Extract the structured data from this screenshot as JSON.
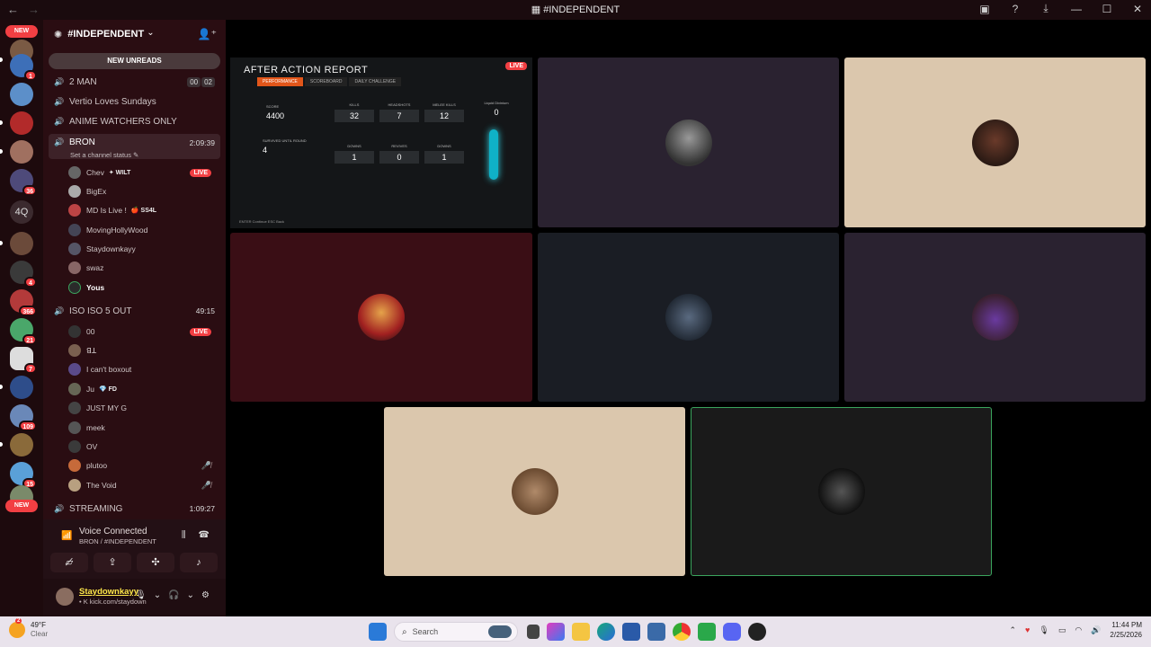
{
  "window": {
    "title": "#INDEPENDENT",
    "back_icon": "←",
    "forward_icon": "→"
  },
  "server_rail": {
    "new_top": "NEW",
    "new_bottom": "NEW",
    "badges": [
      "1",
      "36",
      "4",
      "366",
      "21",
      "7",
      "109",
      "15"
    ],
    "text_server": "4Q"
  },
  "guild": {
    "name": "#INDEPENDENT",
    "chevron": "⌄",
    "new_unreads": "NEW UNREADS"
  },
  "voice_channels": {
    "two_man": {
      "name": "2 MAN",
      "count_a": "00",
      "count_b": "02"
    },
    "vertio": {
      "name": "Vertio Loves Sundays"
    },
    "anime": {
      "name": "ANIME WATCHERS ONLY"
    },
    "bron": {
      "name": "BRON",
      "timer": "2:09:39",
      "status": "Set a channel status ✎"
    },
    "iso": {
      "name": "ISO ISO 5 OUT",
      "timer": "49:15"
    },
    "streaming": {
      "name": "STREAMING",
      "timer": "1:09:27"
    }
  },
  "bron_members": [
    {
      "name": "Chev",
      "tag": "✦ WILT",
      "live": "LIVE"
    },
    {
      "name": "BigEx"
    },
    {
      "name": "MD Is Live !",
      "tag": "🍎 SS4L"
    },
    {
      "name": "MovingHollyWood"
    },
    {
      "name": "Staydownkayy"
    },
    {
      "name": "swaz"
    },
    {
      "name": "Yous"
    }
  ],
  "iso_members": [
    {
      "name": "00",
      "live": "LIVE"
    },
    {
      "name": "ꓭꓕ"
    },
    {
      "name": "I can't boxout"
    },
    {
      "name": "Ju",
      "tag": "💎 FD"
    },
    {
      "name": "JUST MY G"
    },
    {
      "name": "meek"
    },
    {
      "name": "OV"
    },
    {
      "name": "plutoo",
      "mute": "🎤̸"
    },
    {
      "name": "The Void",
      "mute": "🎤̸"
    }
  ],
  "voice_panel": {
    "title": "Voice Connected",
    "subtitle": "BRON / #INDEPENDENT"
  },
  "user_panel": {
    "name": "Staydownkayy",
    "status": "• K kick.com/staydown"
  },
  "game_stream": {
    "title": "AFTER ACTION REPORT",
    "live": "LIVE",
    "tabs": [
      "PERFORMANCE",
      "SCOREBOARD",
      "DAILY CHALLENGE"
    ],
    "score_label": "SCORE",
    "score": "4400",
    "round_label": "SURVIVED UNTIL ROUND",
    "round": "4",
    "kills_label": "KILLS",
    "kills": "32",
    "headshots_label": "HEADSHOTS",
    "headshots": "7",
    "melee_label": "MELEE KILLS",
    "melee": "12",
    "downs_label": "DOWNS",
    "downs": "1",
    "revives_label": "REVIVES",
    "revives": "0",
    "downs2_label": "DOWNS",
    "downs2": "1",
    "liquid_label": "Liquid Divinium",
    "liquid": "0",
    "footer": "ENTER Continue   ESC Back"
  },
  "taskbar": {
    "temp": "49°F",
    "weather": "Clear",
    "weather_badge": "2",
    "search": "Search",
    "time": "11:44 PM",
    "date": "2/25/2026"
  },
  "colors": {
    "channel_bg": "#2a0d12",
    "tile_purple": "#2a2230",
    "tile_beige": "#dbc7ad",
    "tile_maroon": "#3a0e15",
    "tile_navy": "#1a1d24",
    "tile_dark": "#1a1a1a",
    "live_red": "#f23f43"
  }
}
